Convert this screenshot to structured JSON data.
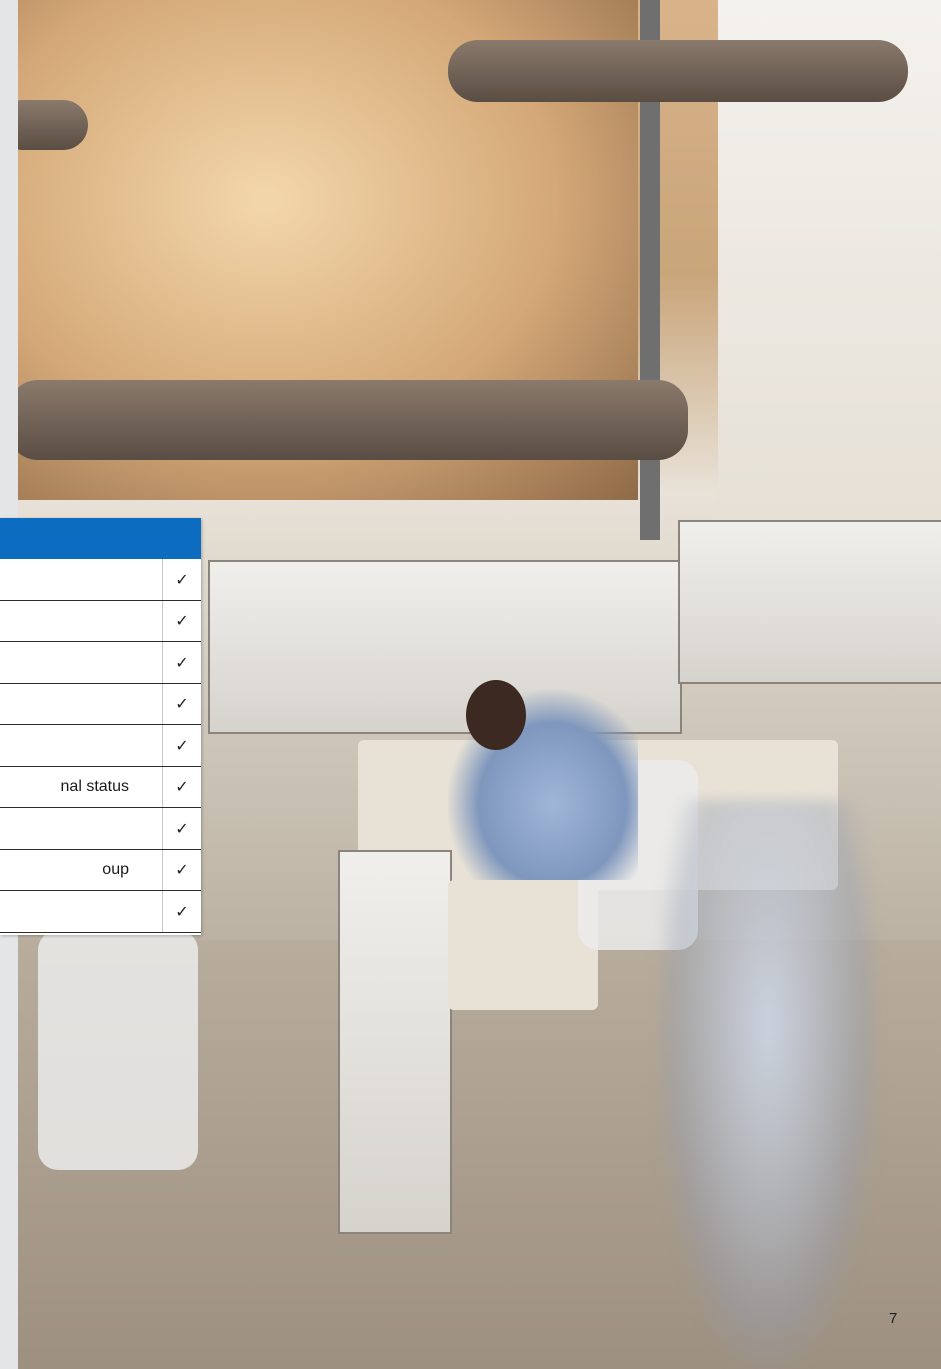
{
  "table": {
    "rows": [
      {
        "label": "",
        "check": "✓"
      },
      {
        "label": "",
        "check": "✓"
      },
      {
        "label": "",
        "check": "✓"
      },
      {
        "label": "",
        "check": "✓"
      },
      {
        "label": "",
        "check": "✓"
      },
      {
        "label": "nal status",
        "check": "✓"
      },
      {
        "label": "",
        "check": "✓"
      },
      {
        "label": "oup",
        "check": "✓"
      },
      {
        "label": "",
        "check": "✓"
      }
    ]
  },
  "page": {
    "number": "7"
  },
  "colors": {
    "header_blue": "#0b6cc0"
  },
  "photo": {
    "description_icon": "office-photo"
  }
}
